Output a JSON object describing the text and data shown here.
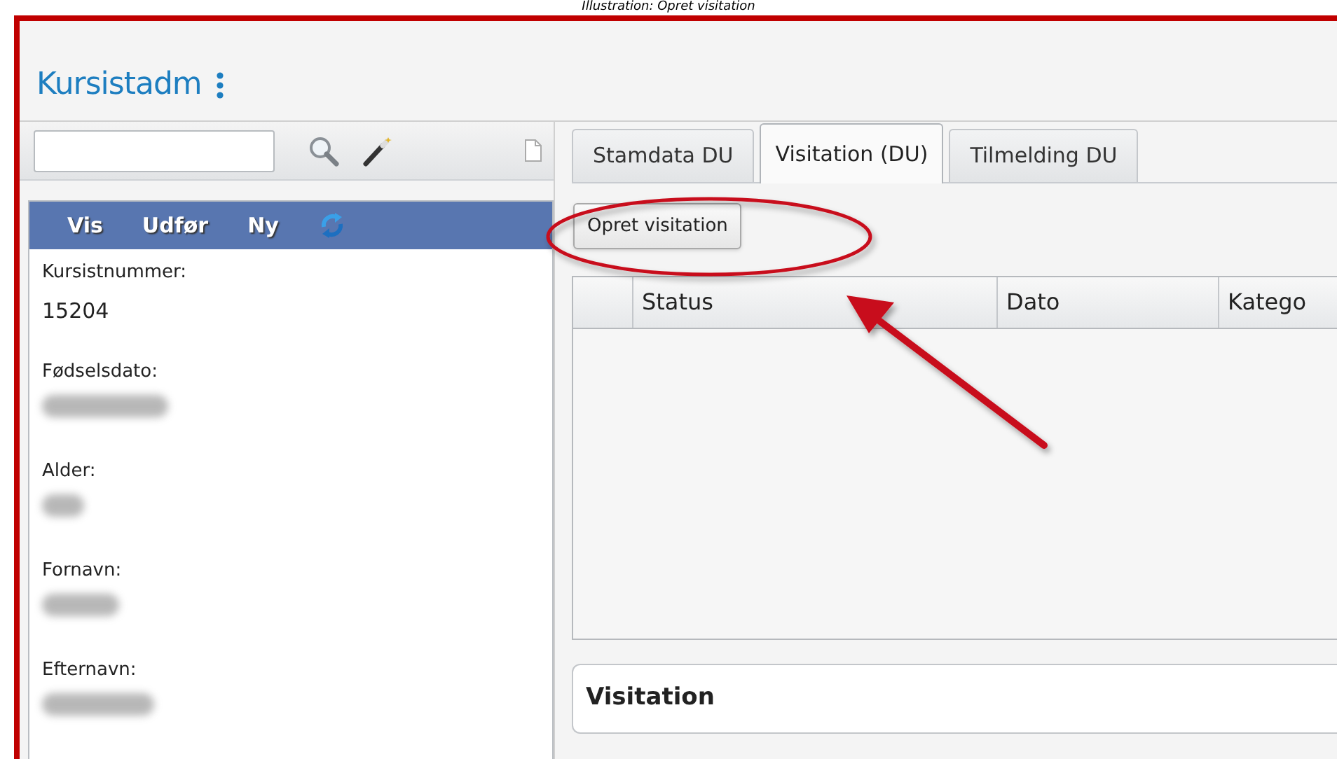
{
  "caption": "Illustration: Opret visitation",
  "app_title": "Kursistadm",
  "actions": [
    "Vis",
    "Udfør",
    "Ny"
  ],
  "fields": [
    {
      "label": "Kursistnummer:",
      "value": "15204",
      "redacted": false
    },
    {
      "label": "Fødselsdato:",
      "redacted": true
    },
    {
      "label": "Alder:",
      "redacted": true
    },
    {
      "label": "Fornavn:",
      "redacted": true
    },
    {
      "label": "Efternavn:",
      "redacted": true
    }
  ],
  "tabs": [
    {
      "label": "Stamdata DU",
      "selected": false
    },
    {
      "label": "Visitation (DU)",
      "selected": true
    },
    {
      "label": "Tilmelding DU",
      "selected": false
    }
  ],
  "create_button": "Opret visitation",
  "table": {
    "columns": [
      "Status",
      "Dato",
      "Katego"
    ]
  },
  "section_title": "Visitation"
}
